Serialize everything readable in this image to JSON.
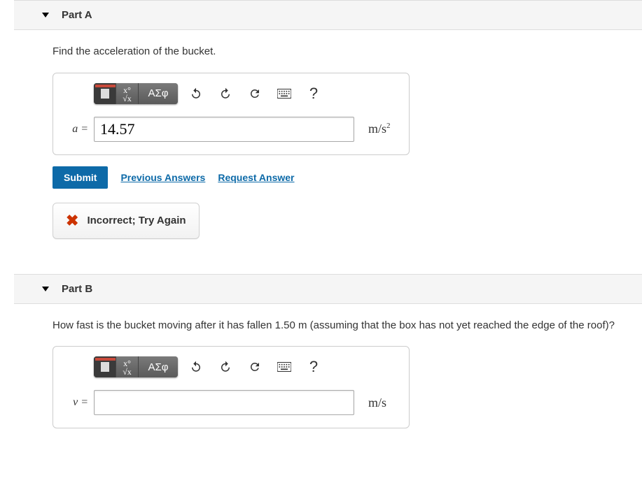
{
  "partA": {
    "title": "Part A",
    "prompt": "Find the acceleration of the bucket.",
    "var_label": "a =",
    "input_value": "14.57",
    "unit_html": "m/s²",
    "submit_label": "Submit",
    "prev_answers_label": "Previous Answers",
    "request_answer_label": "Request Answer",
    "feedback": "Incorrect; Try Again"
  },
  "partB": {
    "title": "Part B",
    "prompt": "How fast is the bucket moving after it has fallen 1.50 m (assuming that the box has not yet reached the edge of the roof)?",
    "var_label": "v =",
    "input_value": "",
    "unit_html": "m/s"
  },
  "toolbar": {
    "greek_label": "ΑΣφ",
    "help_label": "?"
  }
}
